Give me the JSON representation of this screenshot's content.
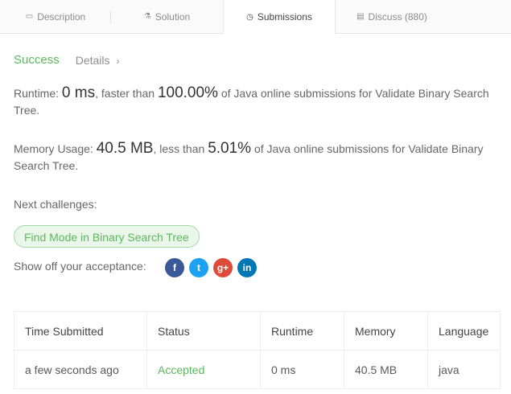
{
  "tabs": [
    {
      "label": "Description",
      "icon": "document-icon"
    },
    {
      "label": "Solution",
      "icon": "flask-icon"
    },
    {
      "label": "Submissions",
      "icon": "clock-icon"
    },
    {
      "label": "Discuss (880)",
      "icon": "comment-icon"
    }
  ],
  "active_tab": "Submissions",
  "result": {
    "status": "Success",
    "details_label": "Details"
  },
  "runtime": {
    "label": "Runtime:",
    "value": "0 ms",
    "mid": ", faster than",
    "percent": "100.00%",
    "suffix": "of Java online submissions for Validate Binary Search Tree."
  },
  "memory": {
    "label": "Memory Usage:",
    "value": "40.5 MB",
    "mid": ", less than",
    "percent": "5.01%",
    "suffix": "of Java online submissions for Validate Binary Search Tree."
  },
  "next_label": "Next challenges:",
  "challenge": "Find Mode in Binary Search Tree",
  "showoff_label": "Show off your acceptance:",
  "social": [
    "facebook-icon",
    "twitter-icon",
    "google-plus-icon",
    "linkedin-icon"
  ],
  "table": {
    "headers": [
      "Time Submitted",
      "Status",
      "Runtime",
      "Memory",
      "Language"
    ],
    "rows": [
      [
        "a few seconds ago",
        "Accepted",
        "0 ms",
        "40.5 MB",
        "java"
      ]
    ]
  },
  "colors": {
    "success": "#5cb85c",
    "facebook": "#3b5998",
    "twitter": "#1da1f2",
    "google": "#dd4b39",
    "linkedin": "#0077b5"
  }
}
